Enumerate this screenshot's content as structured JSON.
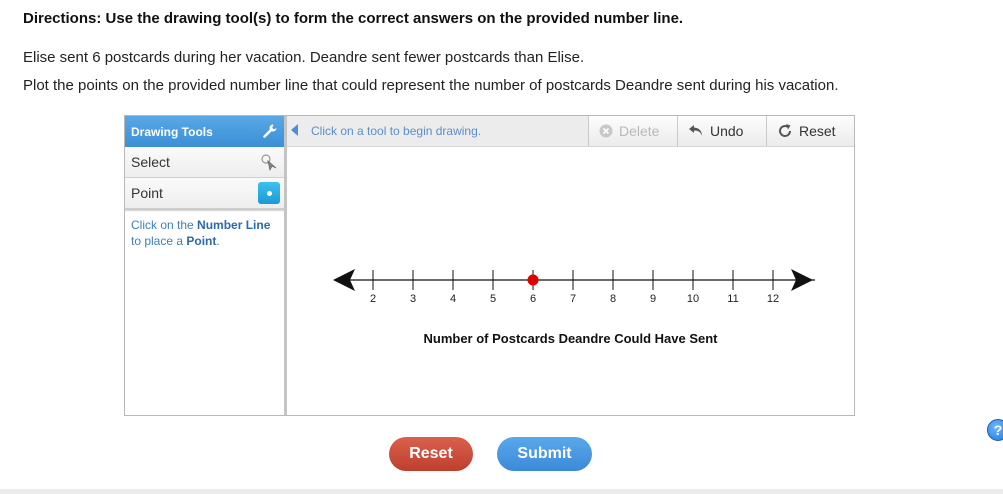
{
  "directions": "Directions: Use the drawing tool(s) to form the correct answers on the provided number line.",
  "prompt_lines": [
    "Elise sent 6 postcards during her vacation. Deandre sent fewer postcards than Elise.",
    "Plot the points on the provided number line that could represent the number of postcards Deandre sent during his vacation."
  ],
  "tools": {
    "header": "Drawing Tools",
    "items": [
      {
        "label": "Select",
        "icon": "cursor-icon"
      },
      {
        "label": "Point",
        "icon": "point-icon"
      }
    ],
    "hint_parts": [
      "Click on the ",
      "Number Line",
      " to place a ",
      "Point",
      "."
    ]
  },
  "toolbar": {
    "status": "Click on a tool to begin drawing.",
    "delete_label": "Delete",
    "undo_label": "Undo",
    "reset_label": "Reset"
  },
  "number_line": {
    "min": 2,
    "max": 12,
    "ticks": [
      "2",
      "3",
      "4",
      "5",
      "6",
      "7",
      "8",
      "9",
      "10",
      "11",
      "12"
    ],
    "plotted_points": [
      6
    ],
    "point_color": "#e00000",
    "axis_label": "Number of Postcards Deandre Could Have Sent"
  },
  "help_label": "?",
  "buttons": {
    "reset": "Reset",
    "submit": "Submit"
  }
}
